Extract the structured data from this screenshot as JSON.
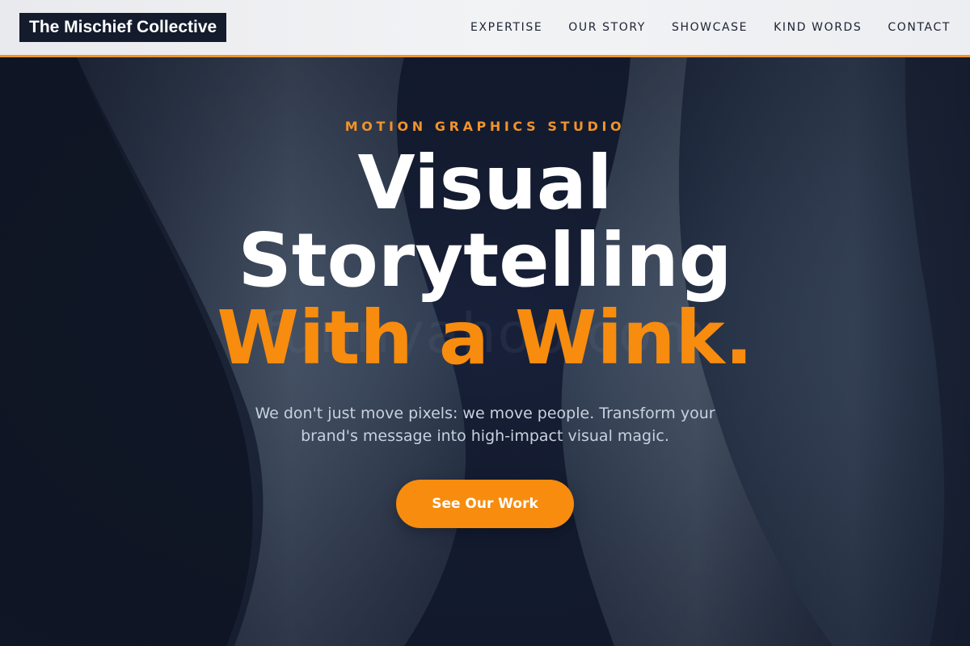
{
  "header": {
    "logo_text": "The Mischief Collective",
    "nav": [
      {
        "label": "EXPERTISE"
      },
      {
        "label": "OUR STORY"
      },
      {
        "label": "SHOWCASE"
      },
      {
        "label": "KIND WORDS"
      },
      {
        "label": "CONTACT"
      }
    ]
  },
  "hero": {
    "eyebrow": "MOTION GRAPHICS STUDIO",
    "headline_line1": "Visual",
    "headline_line2": "Storytelling",
    "headline_line3": "With a Wink.",
    "subtext": "We don't just move pixels: we move people. Transform your brand's message into high-impact visual magic.",
    "cta_label": "See Our Work",
    "watermark": "funnyahoo.com"
  },
  "colors": {
    "accent": "#f78c0f",
    "header_border": "#f0932b",
    "dark_navy": "#131b2c",
    "subtext": "#c8d1df"
  }
}
